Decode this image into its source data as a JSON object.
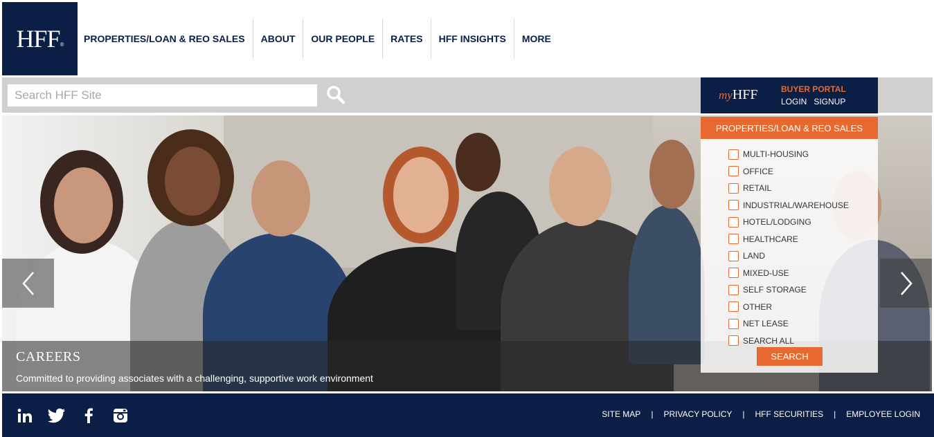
{
  "logo": {
    "text": "HFF",
    "mark": "®"
  },
  "nav": [
    {
      "label": "PROPERTIES/LOAN & REO SALES"
    },
    {
      "label": "ABOUT"
    },
    {
      "label": "OUR PEOPLE"
    },
    {
      "label": "RATES"
    },
    {
      "label": "HFF INSIGHTS"
    },
    {
      "label": "MORE"
    }
  ],
  "search": {
    "placeholder": "Search HFF Site",
    "icon": "search-icon"
  },
  "portal": {
    "my": "my",
    "brand": "HFF",
    "title": "BUYER PORTAL",
    "login": "LOGIN",
    "signup": "SIGNUP"
  },
  "hero": {
    "title": "CAREERS",
    "subtitle": "Committed to providing associates with a challenging, supportive work environment",
    "prev_icon": "chevron-left-icon",
    "next_icon": "chevron-right-icon"
  },
  "properties_panel": {
    "header": "PROPERTIES/LOAN & REO SALES",
    "options": [
      {
        "label": "MULTI-HOUSING"
      },
      {
        "label": "OFFICE"
      },
      {
        "label": "RETAIL"
      },
      {
        "label": "INDUSTRIAL/WAREHOUSE"
      },
      {
        "label": "HOTEL/LODGING"
      },
      {
        "label": "HEALTHCARE"
      },
      {
        "label": "LAND"
      },
      {
        "label": "MIXED-USE"
      },
      {
        "label": "SELF STORAGE"
      },
      {
        "label": "OTHER"
      },
      {
        "label": "NET LEASE"
      },
      {
        "label": "SEARCH ALL"
      }
    ],
    "search_button": "SEARCH"
  },
  "footer": {
    "social": [
      "linkedin-icon",
      "twitter-icon",
      "facebook-icon",
      "instagram-icon"
    ],
    "links": [
      {
        "label": "SITE MAP"
      },
      {
        "label": "PRIVACY POLICY"
      },
      {
        "label": "HFF SECURITIES"
      },
      {
        "label": "EMPLOYEE LOGIN"
      }
    ]
  },
  "colors": {
    "navy": "#0b1e45",
    "orange": "#e8692f",
    "gray_bar": "#d0d0d0"
  }
}
